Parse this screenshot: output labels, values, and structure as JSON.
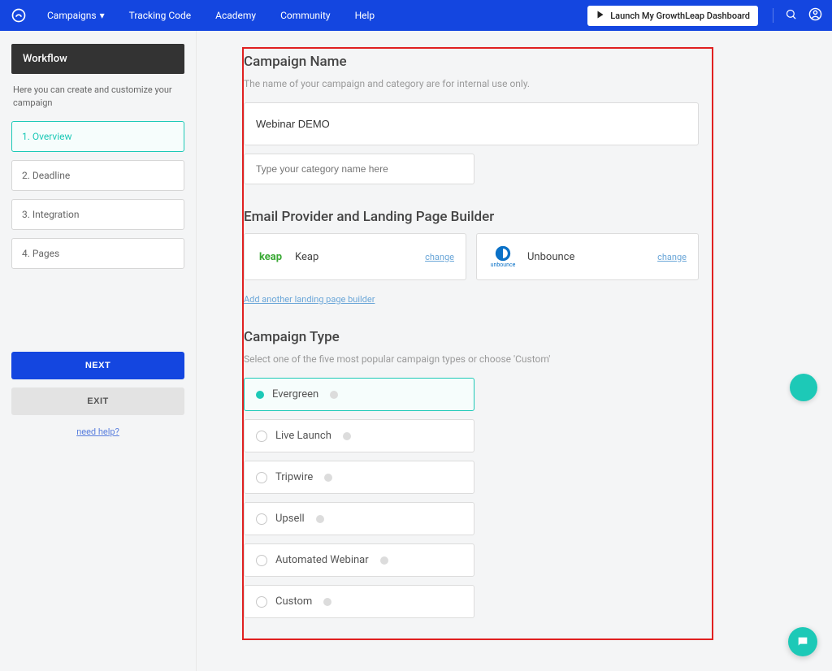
{
  "nav": {
    "links": [
      "Campaigns",
      "Tracking Code",
      "Academy",
      "Community",
      "Help"
    ],
    "launch": "Launch My GrowthLeap Dashboard"
  },
  "sidebar": {
    "title": "Workflow",
    "desc": "Here you can create and customize your campaign",
    "steps": [
      {
        "label": "1. Overview",
        "active": true
      },
      {
        "label": "2. Deadline",
        "active": false
      },
      {
        "label": "3. Integration",
        "active": false
      },
      {
        "label": "4. Pages",
        "active": false
      }
    ],
    "next": "NEXT",
    "exit": "EXIT",
    "help": "need help?"
  },
  "campaignName": {
    "title": "Campaign Name",
    "sub": "The name of your campaign and category are for internal use only.",
    "value": "Webinar DEMO",
    "categoryPlaceholder": "Type your category name here"
  },
  "providers": {
    "title": "Email Provider and Landing Page Builder",
    "items": [
      {
        "name": "Keap",
        "logo": "keap"
      },
      {
        "name": "Unbounce",
        "logo": "unbounce"
      }
    ],
    "change": "change",
    "add": "Add another landing page builder"
  },
  "campaignType": {
    "title": "Campaign Type",
    "sub": "Select one of the five most popular campaign types or choose 'Custom'",
    "options": [
      {
        "label": "Evergreen",
        "selected": true
      },
      {
        "label": "Live Launch",
        "selected": false
      },
      {
        "label": "Tripwire",
        "selected": false
      },
      {
        "label": "Upsell",
        "selected": false
      },
      {
        "label": "Automated Webinar",
        "selected": false
      },
      {
        "label": "Custom",
        "selected": false
      }
    ]
  }
}
